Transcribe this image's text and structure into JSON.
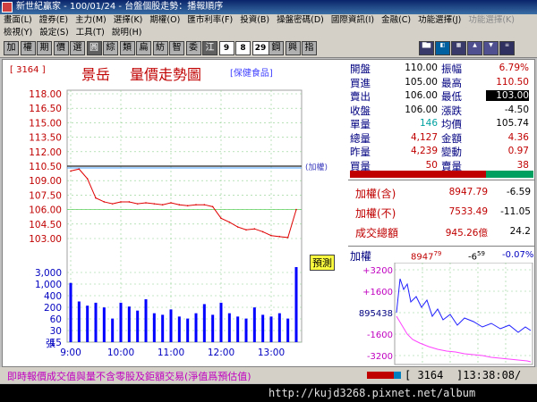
{
  "window": {
    "title": "新世紀贏家 - 100/01/24 - 台盤個股走勢：播報順序"
  },
  "menu1": [
    "畫面(L)",
    "證券(E)",
    "主力(M)",
    "選擇(K)",
    "期權(O)",
    "匯市利率(F)",
    "投資(B)",
    "操盤密碼(D)",
    "國際資訊(I)",
    "金融(C)",
    "功能選擇(J)",
    "功能選擇(K)"
  ],
  "menu2": [
    "檢視(Y)",
    "設定(S)",
    "工具(T)",
    "說明(H)"
  ],
  "toolbar": [
    "加",
    "權",
    "期",
    "價",
    "選",
    "圓",
    "綜",
    "類",
    "扁",
    "紡",
    "智",
    "委",
    "江",
    "9",
    "8",
    "29",
    "鋼",
    "興",
    "指"
  ],
  "header": {
    "code": "[ 3164 ]",
    "name": "景岳",
    "chart_title": "量價走勢圖",
    "category": "[保健食品]"
  },
  "price_axis": [
    "118.00",
    "116.50",
    "115.00",
    "113.50",
    "112.00",
    "110.50",
    "109.00",
    "107.50",
    "106.00",
    "104.50",
    "103.00"
  ],
  "volume_axis": [
    "3,000",
    "1,000",
    "400",
    "200",
    "60",
    "30",
    "15"
  ],
  "volume_unit": "張",
  "time_axis": [
    "9:00",
    "10:00",
    "11:00",
    "12:00",
    "13:00"
  ],
  "tags": {
    "weighted": "(加權)",
    "forecast": "預測"
  },
  "quote": {
    "left": [
      {
        "label": "開盤",
        "value": "110.00",
        "color": "#000000"
      },
      {
        "label": "買進",
        "value": "105.00",
        "color": "#000000"
      },
      {
        "label": "賣出",
        "value": "106.00",
        "color": "#000000"
      },
      {
        "label": "收盤",
        "value": "106.00",
        "color": "#000000"
      },
      {
        "label": "單量",
        "value": "146",
        "color": "#00a0a0"
      },
      {
        "label": "總量",
        "value": "4,127",
        "color": "#c00000"
      },
      {
        "label": "昨量",
        "value": "4,239",
        "color": "#c00000"
      },
      {
        "label": "買量",
        "value": "50",
        "color": "#c00000"
      }
    ],
    "right": [
      {
        "label": "振幅",
        "value": "6.79%",
        "color": "#c00000"
      },
      {
        "label": "最高",
        "value": "110.50",
        "color": "#c00000"
      },
      {
        "label": "最低",
        "value": "103.00",
        "color": "#ffffff"
      },
      {
        "label": "漲跌",
        "value": "-4.50",
        "color": "#000000"
      },
      {
        "label": "均價",
        "value": "105.74",
        "color": "#000000"
      },
      {
        "label": "金額",
        "value": "4.36",
        "color": "#c00000"
      },
      {
        "label": "變動",
        "value": "0.97",
        "color": "#c00000"
      },
      {
        "label": "賣量",
        "value": "38",
        "color": "#c00000"
      }
    ]
  },
  "index_box": [
    {
      "label": "加權(含)",
      "value": "8947.79",
      "change": "-6.59"
    },
    {
      "label": "加權(不)",
      "value": "7533.49",
      "change": "-11.05"
    },
    {
      "label": "成交總額",
      "value": "945.26億",
      "change": "24.2"
    }
  ],
  "mini": {
    "label": "加權",
    "value_main": "8947",
    "value_sup": "79",
    "change_main": "-6",
    "change_sup": "59",
    "pct": "-0.07%",
    "axis": [
      "+3200",
      "+1600",
      "895438",
      "-1600",
      "-3200"
    ]
  },
  "footer": {
    "note": "即時報價成交值與量不含零股及鉅額交易(淨值爲預估值)",
    "code": "[ 3164",
    "time": "]13:38:08/",
    "watermark": "http://kujd3268.pixnet.net/album"
  },
  "colors": {
    "price_line": "#e00000",
    "avg_line": "#4aa0ff",
    "volume_bar": "#0000ff",
    "grid": "#8fd08f",
    "prev_close": "#202020"
  },
  "chart_data": {
    "type": "line",
    "title": "量價走勢圖",
    "x": [
      "09:00",
      "09:10",
      "09:20",
      "09:30",
      "09:40",
      "09:50",
      "10:00",
      "10:10",
      "10:20",
      "10:30",
      "10:40",
      "10:50",
      "11:00",
      "11:10",
      "11:20",
      "11:30",
      "11:40",
      "11:50",
      "12:00",
      "12:10",
      "12:20",
      "12:30",
      "12:40",
      "12:50",
      "13:00",
      "13:10",
      "13:20",
      "13:30"
    ],
    "series": [
      {
        "name": "price",
        "values": [
          110.0,
          110.2,
          109.2,
          107.2,
          106.8,
          106.6,
          106.8,
          106.8,
          106.6,
          106.7,
          106.6,
          106.5,
          106.7,
          106.5,
          106.4,
          106.5,
          106.5,
          106.3,
          105.1,
          104.7,
          104.2,
          103.9,
          104.0,
          103.7,
          103.3,
          103.2,
          103.1,
          106.0
        ]
      }
    ],
    "ylim": [
      103,
      118
    ],
    "prev_close": 110.5,
    "volume": [
      900,
      220,
      160,
      200,
      140,
      60,
      200,
      150,
      110,
      260,
      90,
      80,
      120,
      70,
      60,
      90,
      180,
      80,
      200,
      90,
      70,
      60,
      140,
      80,
      70,
      90,
      60,
      3000
    ]
  }
}
